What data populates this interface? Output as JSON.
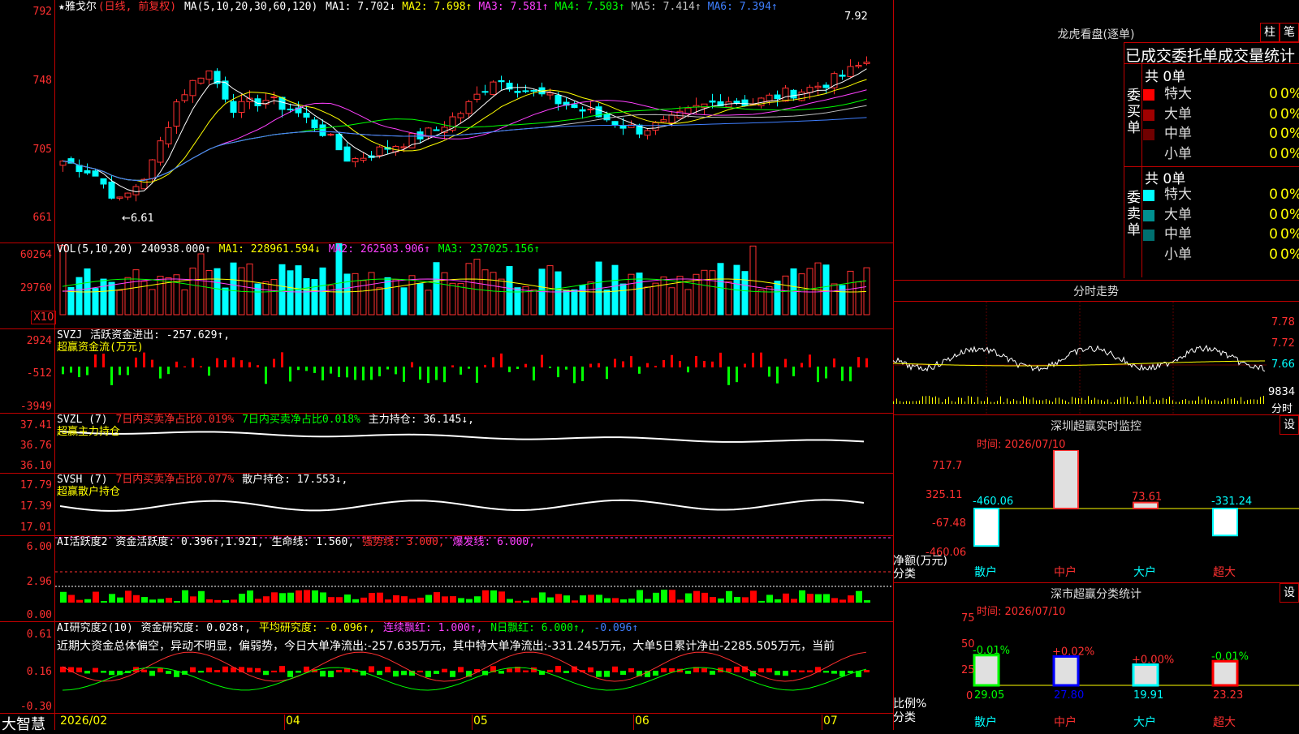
{
  "main": {
    "title": "★雅戈尔",
    "subtitle": "(日线, 前复权)",
    "ma_label": "MA(5,10,20,30,60,120)",
    "ma_values": [
      {
        "label": "MA1: 7.702↓",
        "color": "#ffffff"
      },
      {
        "label": "MA2: 7.698↑",
        "color": "#ffff00"
      },
      {
        "label": "MA3: 7.581↑",
        "color": "#ff40ff"
      },
      {
        "label": "MA4: 7.503↑",
        "color": "#00ff00"
      },
      {
        "label": "MA5: 7.414↑",
        "color": "#c0c0c0"
      },
      {
        "label": "MA6: 7.394↑",
        "color": "#3f7fff"
      }
    ],
    "y_ticks": [
      "792",
      "748",
      "705",
      "661"
    ],
    "high_label": "7.92",
    "low_label": "←6.61"
  },
  "vol": {
    "header": "VOL(5,10,20)",
    "value": "240938.000↑",
    "ma1": "MA1: 228961.594↓",
    "ma2": "MA2: 262503.906↑",
    "ma3": "MA3: 237025.156↑",
    "y_ticks": [
      "60264",
      "29760"
    ],
    "unit": "X10"
  },
  "svzj": {
    "header": "SVZJ",
    "value": "活跃资金进出: -257.629↑,",
    "subtitle": "超赢资金流(万元)",
    "y_ticks": [
      "2924",
      "-512",
      "-3949"
    ]
  },
  "svzl": {
    "header": "SVZL (7)",
    "text1": "7日内买卖净占比0.019%",
    "text2": "7日内买卖净占比0.018%",
    "text3": "主力持仓: 36.145↓,",
    "subtitle": "超赢主力持仓",
    "y_ticks": [
      "37.41",
      "36.76",
      "36.10"
    ]
  },
  "svsh": {
    "header": "SVSH (7)",
    "text1": "7日内买卖净占比0.077%",
    "text2": "散户持仓: 17.553↓,",
    "subtitle": "超赢散户持仓",
    "y_ticks": [
      "17.79",
      "17.39",
      "17.01"
    ]
  },
  "ai_active": {
    "header": "AI活跃度2",
    "value": "资金活跃度: 0.396↑,1.921,",
    "line1": "生命线: 1.560,",
    "line2": "强势线: 3.000,",
    "line3": "爆发线: 6.000,",
    "y_ticks": [
      "6.00",
      "2.96",
      "0.00"
    ]
  },
  "ai_research": {
    "header": "AI研究度2(10)",
    "value": "资金研究度: 0.028↑,",
    "avg": "平均研究度: -0.096↑,",
    "red1": "连续飘红: 1.000↑,",
    "red2": "N日飘红: 6.000↑,",
    "tail": "-0.096↑",
    "summary": "近期大资金总体偏空，异动不明显，偏弱势，今日大单净流出:-257.635万元，其中特大单净流出:-331.245万元，大单5日累计净出-2285.505万元，当前",
    "y_ticks": [
      "0.61",
      "0.16",
      "-0.30"
    ]
  },
  "xaxis": {
    "brand": "大智慧",
    "labels": [
      "2026/02",
      "04",
      "05",
      "06",
      "07"
    ]
  },
  "right": {
    "lhb_title": "龙虎看盘(逐单)",
    "btn_zhu": "柱",
    "btn_bi": "笔",
    "stats_title": "已成交委托单成交量统计",
    "buy_total": "共 0单",
    "buy_label": "委买单",
    "sell_total": "共 0单",
    "sell_label": "委卖单",
    "buy_rows": [
      {
        "name": "特大",
        "v1": "0",
        "v2": "0%",
        "color": "#ff0000"
      },
      {
        "name": "大单",
        "v1": "0",
        "v2": "0%",
        "color": "#a00000"
      },
      {
        "name": "中单",
        "v1": "0",
        "v2": "0%",
        "color": "#700000"
      },
      {
        "name": "小单",
        "v1": "0",
        "v2": "0%",
        "color": ""
      }
    ],
    "sell_rows": [
      {
        "name": "特大",
        "v1": "0",
        "v2": "0%",
        "color": "#00ffff"
      },
      {
        "name": "大单",
        "v1": "0",
        "v2": "0%",
        "color": "#009090"
      },
      {
        "name": "中单",
        "v1": "0",
        "v2": "0%",
        "color": "#007070"
      },
      {
        "name": "小单",
        "v1": "0",
        "v2": "0%",
        "color": ""
      }
    ],
    "intraday_title": "分时走势",
    "intraday_ticks": [
      "7.78",
      "7.72",
      "7.66",
      "9834"
    ],
    "intraday_unit": "分时",
    "monitor_title": "深圳超赢实时监控",
    "monitor_btn": "设",
    "monitor_time": "时间: 2026/07/10",
    "monitor_ticks": [
      "717.7",
      "325.11",
      "-67.48",
      "-460.06"
    ],
    "monitor_unit1": "净额(万元)",
    "monitor_unit2": "分类",
    "monitor_bars": [
      {
        "name": "散户",
        "value": "-460.06",
        "num": -460.06
      },
      {
        "name": "中户",
        "value": "717.7",
        "num": 717.7
      },
      {
        "name": "大户",
        "value": "73.61",
        "num": 73.61
      },
      {
        "name": "超大",
        "value": "-331.24",
        "num": -331.24
      }
    ],
    "class_title": "深市超赢分类统计",
    "class_btn": "设",
    "class_time": "时间: 2026/07/10",
    "class_ticks": [
      "75",
      "50",
      "25",
      "0"
    ],
    "class_unit1": "比例%",
    "class_unit2": "分类",
    "class_bars": [
      {
        "name": "散户",
        "top": "-0.01%",
        "value": "29.05",
        "num": 29.05
      },
      {
        "name": "中户",
        "top": "+0.02%",
        "value": "27.80",
        "num": 27.8
      },
      {
        "name": "大户",
        "top": "+0.00%",
        "value": "19.91",
        "num": 19.91
      },
      {
        "name": "超大",
        "top": "-0.01%",
        "value": "23.23",
        "num": 23.23
      }
    ]
  }
}
